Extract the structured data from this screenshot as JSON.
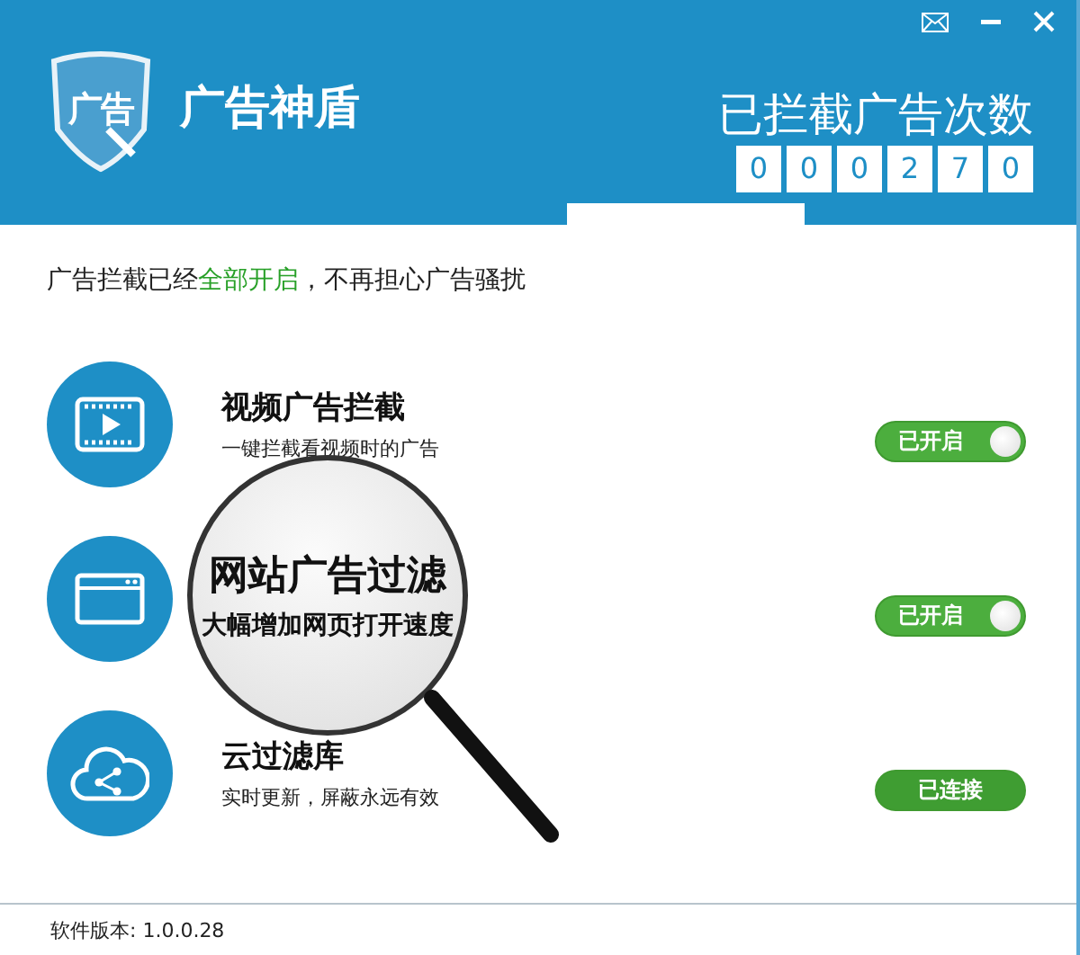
{
  "header": {
    "logo_text": "广告",
    "app_name": "广告神盾",
    "counter_label": "已拦截广告次数",
    "counter_digits": [
      "0",
      "0",
      "0",
      "2",
      "7",
      "0"
    ]
  },
  "headline": "广告拦截已经**全部开启**，不再担心广告骚扰",
  "features": [
    {
      "title": "视频广告拦截",
      "subtitle": "一键拦截看视频时的广告",
      "magnified": false,
      "control": {
        "kind": "switch",
        "label": "已开启",
        "on": true
      }
    },
    {
      "title": "网站广告过滤",
      "subtitle": "大幅增加网页打开速度",
      "magnified": true,
      "control": {
        "kind": "switch",
        "label": "已开启",
        "on": true
      }
    },
    {
      "title": "云过滤库",
      "subtitle": "实时更新，屏蔽永远有效",
      "magnified": false,
      "control": {
        "kind": "status",
        "label": "已连接"
      }
    }
  ],
  "footer": {
    "version": "软件版本: 1.0.0.28"
  }
}
